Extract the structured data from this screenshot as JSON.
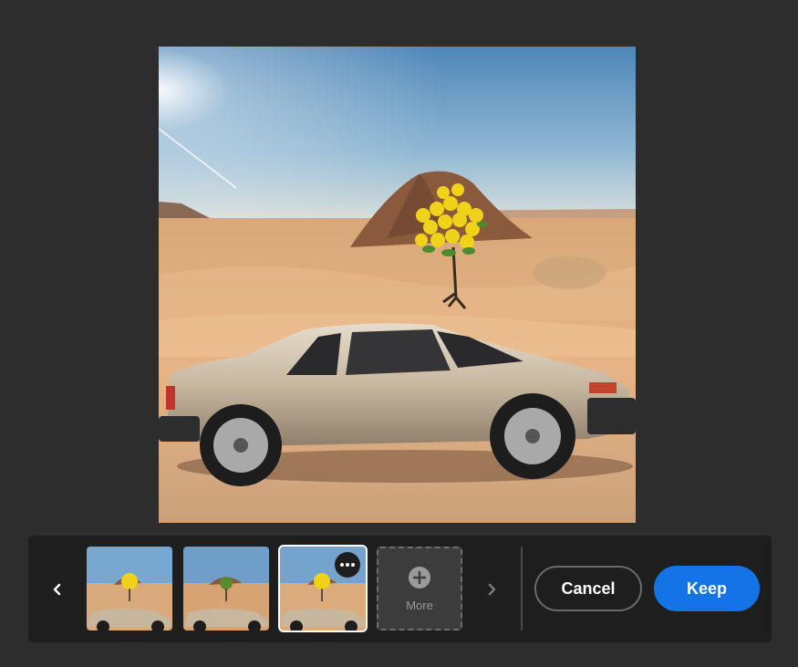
{
  "canvas": {
    "image_description_icon": "generated-image",
    "scene": "desert-car-lemon-tree"
  },
  "variations": {
    "items": [
      {
        "id": "v1",
        "selected": false
      },
      {
        "id": "v2",
        "selected": false
      },
      {
        "id": "v3",
        "selected": true
      }
    ],
    "more_label": "More",
    "prev_icon": "chevron-left-icon",
    "next_icon": "chevron-right-icon",
    "menu_icon": "ellipsis-icon"
  },
  "actions": {
    "cancel_label": "Cancel",
    "keep_label": "Keep"
  },
  "colors": {
    "background": "#2d2d2d",
    "panel": "#1e1e1e",
    "accent": "#1473e6"
  }
}
